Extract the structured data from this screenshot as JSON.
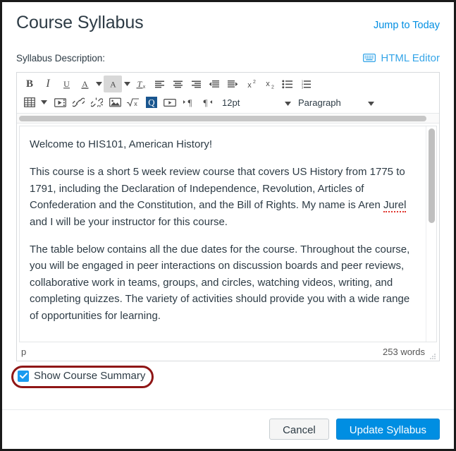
{
  "header": {
    "title": "Course Syllabus",
    "jump_link": "Jump to Today"
  },
  "description": {
    "label": "Syllabus Description:",
    "html_editor_label": "HTML Editor",
    "html_editor_icon": "keyboard-icon"
  },
  "toolbar": {
    "row1": [
      {
        "name": "bold-button",
        "glyph": "B",
        "kind": "text-bold",
        "active": false
      },
      {
        "name": "italic-button",
        "glyph": "I",
        "kind": "text-italic",
        "active": false
      },
      {
        "name": "underline-button",
        "glyph": "underline-icon",
        "kind": "icon",
        "active": false
      },
      {
        "name": "text-color-button",
        "glyph": "text-color-icon",
        "kind": "icon",
        "active": false
      },
      {
        "name": "text-color-dropdown",
        "glyph": "chevron-down-icon",
        "kind": "caret",
        "active": false
      },
      {
        "name": "highlight-color-button",
        "glyph": "highlight-color-icon",
        "kind": "icon",
        "active": true
      },
      {
        "name": "highlight-color-dropdown",
        "glyph": "chevron-down-icon",
        "kind": "caret",
        "active": false
      },
      {
        "name": "clear-formatting-button",
        "glyph": "clear-formatting-icon",
        "kind": "icon",
        "active": false
      },
      {
        "name": "align-left-button",
        "glyph": "align-left-icon",
        "kind": "icon",
        "active": false
      },
      {
        "name": "align-center-button",
        "glyph": "align-center-icon",
        "kind": "icon",
        "active": false
      },
      {
        "name": "align-right-button",
        "glyph": "align-right-icon",
        "kind": "icon",
        "active": false
      },
      {
        "name": "outdent-button",
        "glyph": "outdent-icon",
        "kind": "icon",
        "active": false
      },
      {
        "name": "indent-button",
        "glyph": "indent-icon",
        "kind": "icon",
        "active": false
      },
      {
        "name": "superscript-button",
        "glyph": "superscript-icon",
        "kind": "icon",
        "active": false
      },
      {
        "name": "subscript-button",
        "glyph": "subscript-icon",
        "kind": "icon",
        "active": false
      },
      {
        "name": "bulleted-list-button",
        "glyph": "bulleted-list-icon",
        "kind": "icon",
        "active": false
      },
      {
        "name": "numbered-list-button",
        "glyph": "numbered-list-icon",
        "kind": "icon",
        "active": false
      }
    ],
    "row2": [
      {
        "name": "table-button",
        "glyph": "table-icon",
        "kind": "icon",
        "active": false
      },
      {
        "name": "table-dropdown",
        "glyph": "chevron-down-icon",
        "kind": "caret",
        "active": false
      },
      {
        "name": "media-button",
        "glyph": "media-icon",
        "kind": "icon",
        "active": false
      },
      {
        "name": "link-button",
        "glyph": "link-icon",
        "kind": "icon",
        "active": false
      },
      {
        "name": "unlink-button",
        "glyph": "unlink-icon",
        "kind": "icon",
        "active": false
      },
      {
        "name": "image-button",
        "glyph": "image-icon",
        "kind": "icon",
        "active": false
      },
      {
        "name": "math-equation-button",
        "glyph": "square-root-icon",
        "kind": "icon",
        "active": false
      },
      {
        "name": "canvas-content-button",
        "glyph": "canvas-q-icon",
        "kind": "icon",
        "active": false
      },
      {
        "name": "embed-video-button",
        "glyph": "video-embed-icon",
        "kind": "icon",
        "active": false
      },
      {
        "name": "ltr-direction-button",
        "glyph": "ltr-icon",
        "kind": "icon",
        "active": false
      },
      {
        "name": "rtl-direction-button",
        "glyph": "rtl-icon",
        "kind": "icon",
        "active": false
      }
    ],
    "font_size": "12pt",
    "block_format": "Paragraph"
  },
  "editor_content": {
    "paragraphs": [
      "Welcome to HIS101, American History!",
      "This course is a short 5 week review course that covers US History from 1775 to 1791, including the Declaration of Independence, Revolution, Articles of Confederation and the Constitution, and the Bill of Rights. My name is Aren ",
      "The table below contains all the due dates for the course. Throughout the course, you will be engaged in peer interactions on discussion boards and peer reviews, collaborative work in teams, groups, and circles, watching videos, writing, and completing quizzes. The variety of activities should provide you with a wide range of opportunities for learning."
    ],
    "misspelled_word": "Jurel",
    "paragraph2_tail": " and I will be your instructor for this course."
  },
  "statusbar": {
    "element_path": "p",
    "word_count": "253 words"
  },
  "course_summary": {
    "label": "Show Course Summary",
    "checked": true,
    "highlight_color": "#8f1616"
  },
  "footer": {
    "cancel_label": "Cancel",
    "submit_label": "Update Syllabus"
  },
  "colors": {
    "link": "#008ee2",
    "primary_button": "#008ee2",
    "checkbox": "#1a9af0",
    "title_text": "#2d3b45",
    "highlight": "#8f1616"
  }
}
